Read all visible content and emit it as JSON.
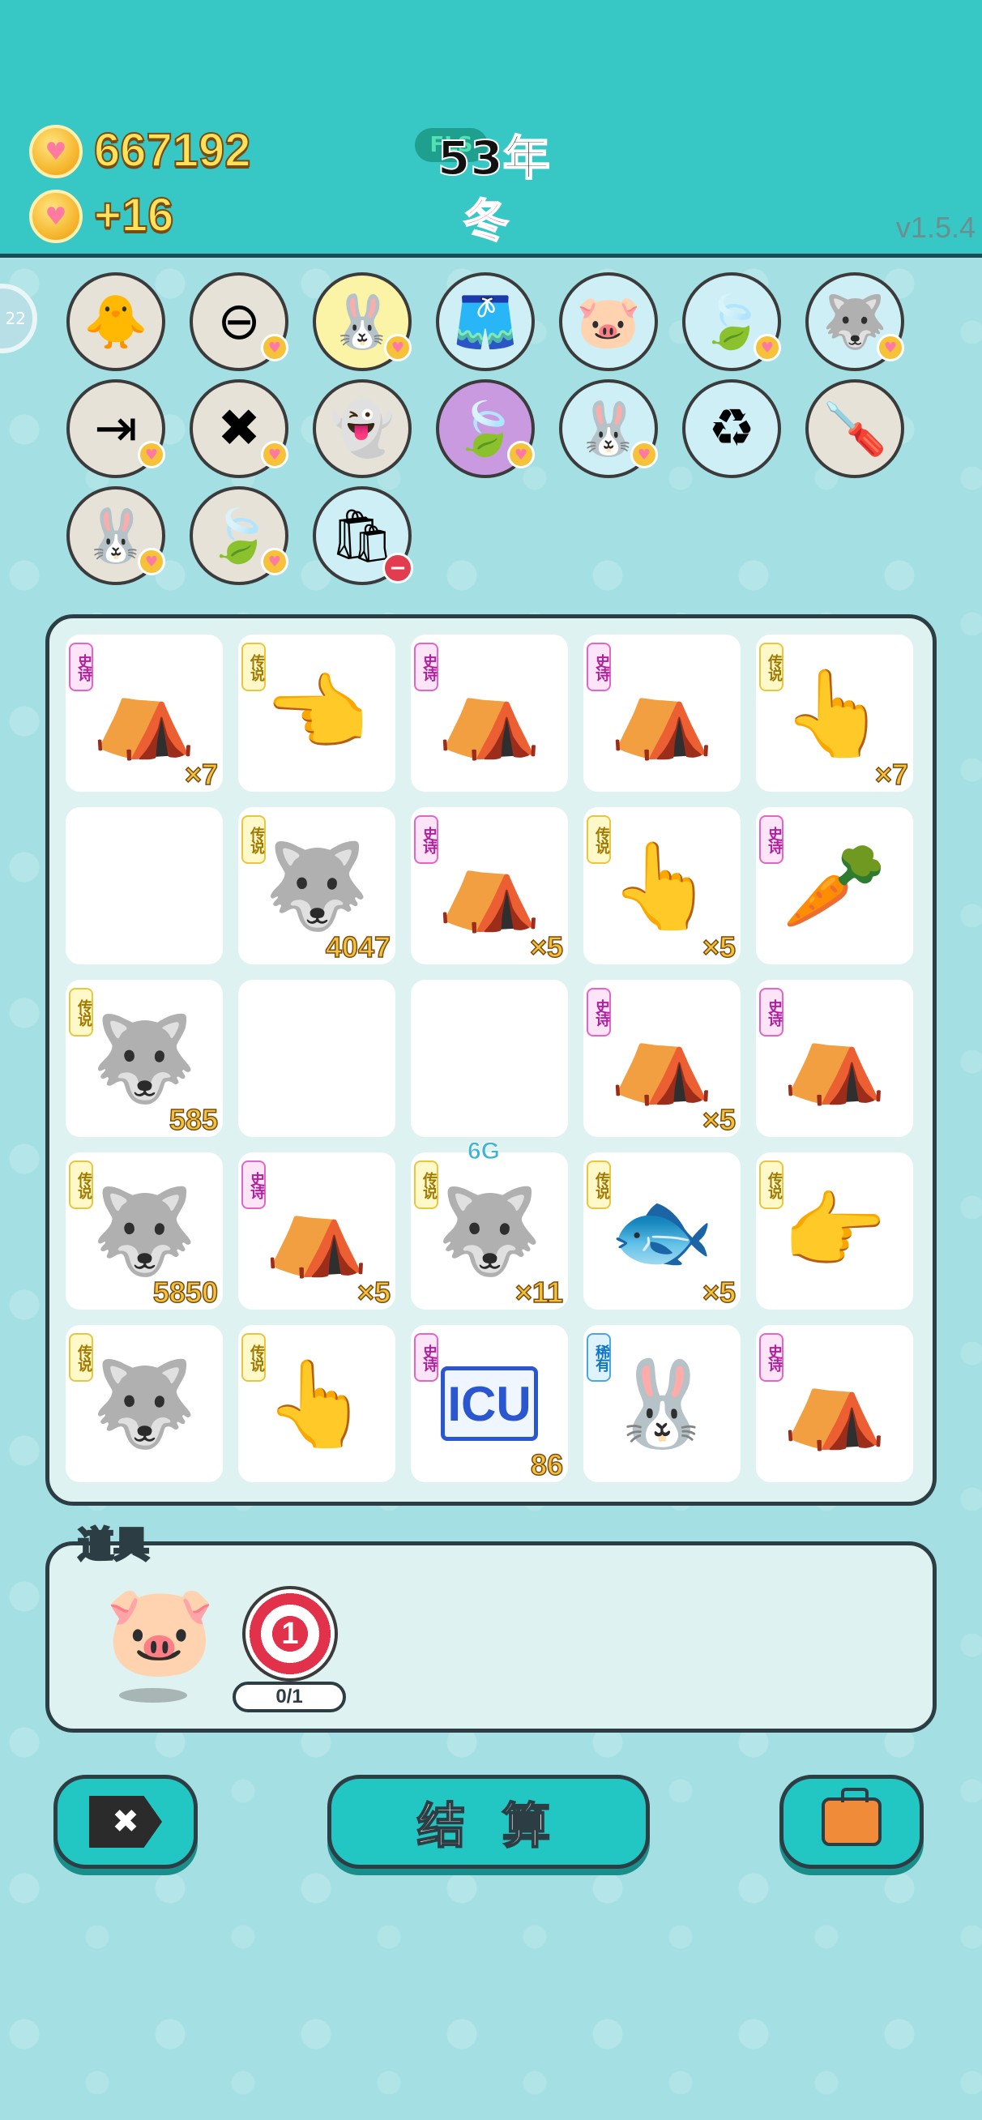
{
  "header": {
    "coins": "667192",
    "income": "+16",
    "year_pill": "FLS",
    "year": "53年",
    "season": "冬",
    "version": "v1.5.4",
    "side_counter": "22"
  },
  "relics": [
    {
      "name": "chick-egg",
      "icon": "🐥",
      "bg": "#e6e2d8",
      "badge": "none"
    },
    {
      "name": "red-no-sign",
      "icon": "⊖",
      "bg": "#e6e2d8",
      "badge": "heart"
    },
    {
      "name": "bunny-yellow",
      "icon": "🐰",
      "bg": "#fbf3a6",
      "badge": "heart"
    },
    {
      "name": "white-skirt",
      "icon": "🩳",
      "bg": "#cdeff5",
      "badge": "none"
    },
    {
      "name": "piggy-bank",
      "icon": "🐷",
      "bg": "#cdeff5",
      "badge": "none"
    },
    {
      "name": "leaf",
      "icon": "🍃",
      "bg": "#cdeff5",
      "badge": "heart"
    },
    {
      "name": "husky",
      "icon": "🐺",
      "bg": "#cdeff5",
      "badge": "heart"
    },
    {
      "name": "skip-arrow",
      "icon": "⇥",
      "bg": "#e6e2d8",
      "badge": "heart"
    },
    {
      "name": "delete-tag",
      "icon": "✖",
      "bg": "#e6e2d8",
      "badge": "heart"
    },
    {
      "name": "ghost",
      "icon": "👻",
      "bg": "#e6e2d8",
      "badge": "none"
    },
    {
      "name": "leaf-purple",
      "icon": "🍃",
      "bg": "#c99ae0",
      "badge": "heart"
    },
    {
      "name": "bunny-blue",
      "icon": "🐰",
      "bg": "#cdeff5",
      "badge": "heart"
    },
    {
      "name": "recycle-bag",
      "icon": "♻",
      "bg": "#cdeff5",
      "badge": "none"
    },
    {
      "name": "screwdriver",
      "icon": "🪛",
      "bg": "#e6e2d8",
      "badge": "none"
    },
    {
      "name": "bunny-pink",
      "icon": "🐰",
      "bg": "#e6e2d8",
      "badge": "heart"
    },
    {
      "name": "leaf-2",
      "icon": "🍃",
      "bg": "#e6e2d8",
      "badge": "heart"
    },
    {
      "name": "trash-bag",
      "icon": "🛍",
      "bg": "#cdeff5",
      "badge": "minus"
    }
  ],
  "board": [
    {
      "tag": "史诗",
      "tier": "epic",
      "icon": "⛺",
      "count": "×7"
    },
    {
      "tag": "传说",
      "tier": "legend",
      "icon": "👈",
      "count": ""
    },
    {
      "tag": "史诗",
      "tier": "epic",
      "icon": "⛺",
      "count": ""
    },
    {
      "tag": "史诗",
      "tier": "epic",
      "icon": "⛺",
      "count": ""
    },
    {
      "tag": "传说",
      "tier": "legend",
      "icon": "👆",
      "count": "×7"
    },
    {
      "tag": "",
      "tier": "",
      "icon": "",
      "count": ""
    },
    {
      "tag": "传说",
      "tier": "legend",
      "icon": "🐺",
      "count": "4047"
    },
    {
      "tag": "史诗",
      "tier": "epic",
      "icon": "⛺",
      "count": "×5"
    },
    {
      "tag": "传说",
      "tier": "legend",
      "icon": "👆",
      "count": "×5"
    },
    {
      "tag": "史诗",
      "tier": "epic",
      "icon": "🥕",
      "count": ""
    },
    {
      "tag": "传说",
      "tier": "legend",
      "icon": "🐺",
      "count": "585"
    },
    {
      "tag": "",
      "tier": "",
      "icon": "",
      "count": ""
    },
    {
      "tag": "",
      "tier": "",
      "icon": "",
      "count": ""
    },
    {
      "tag": "史诗",
      "tier": "epic",
      "icon": "⛺",
      "count": "×5"
    },
    {
      "tag": "史诗",
      "tier": "epic",
      "icon": "⛺",
      "count": ""
    },
    {
      "tag": "传说",
      "tier": "legend",
      "icon": "🐺",
      "count": "5850"
    },
    {
      "tag": "史诗",
      "tier": "epic",
      "icon": "⛺",
      "count": "×5"
    },
    {
      "tag": "传说",
      "tier": "legend",
      "icon": "🐺",
      "count": "×11",
      "note": "6G"
    },
    {
      "tag": "传说",
      "tier": "legend",
      "icon": "🐟",
      "count": "×5"
    },
    {
      "tag": "传说",
      "tier": "legend",
      "icon": "👉",
      "count": ""
    },
    {
      "tag": "传说",
      "tier": "legend",
      "icon": "🐺",
      "count": ""
    },
    {
      "tag": "传说",
      "tier": "legend",
      "icon": "👆",
      "count": ""
    },
    {
      "tag": "史诗",
      "tier": "epic",
      "icon": "ICU",
      "count": "86"
    },
    {
      "tag": "稀有",
      "tier": "rare",
      "icon": "🐰",
      "count": ""
    },
    {
      "tag": "史诗",
      "tier": "epic",
      "icon": "⛺",
      "count": ""
    }
  ],
  "items": {
    "title": "道具",
    "piggy_icon": "🐷",
    "target_value": "1",
    "target_progress": "0/1"
  },
  "buttons": {
    "delete_icon": "✖",
    "settle_label": "结 算",
    "bag_icon": "briefcase-icon"
  }
}
